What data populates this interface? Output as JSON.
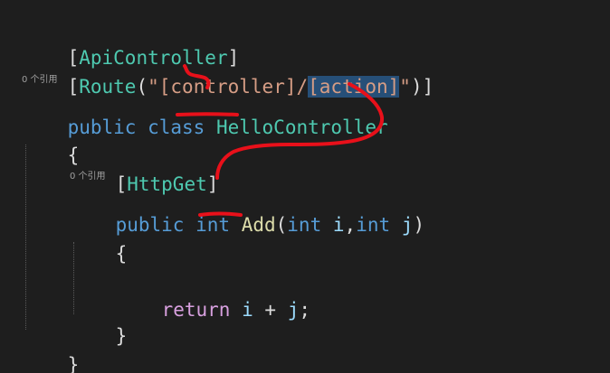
{
  "code": {
    "line1": {
      "open": "[",
      "attr": "ApiController",
      "close": "]"
    },
    "line2": {
      "open": "[",
      "attr": "Route",
      "paren_open": "(",
      "quote_open": "\"",
      "template_part1": "[controller]/",
      "template_part2": "[action]",
      "quote_close": "\"",
      "paren_close": ")",
      "close": "]"
    },
    "codelens_class": "0 个引用",
    "line3": {
      "kw_public": "public",
      "kw_class": "class",
      "class_name": "HelloController"
    },
    "line4": {
      "brace": "{"
    },
    "line5": {
      "open": "[",
      "attr": "HttpGet",
      "close": "]"
    },
    "codelens_method": "0 个引用",
    "line6": {
      "kw_public": "public",
      "kw_int": "int",
      "method_name": "Add",
      "paren_open": "(",
      "p1_type": "int",
      "p1_name": "i",
      "comma": ",",
      "p2_type": "int",
      "p2_name": "j",
      "paren_close": ")"
    },
    "line7": {
      "brace": "{"
    },
    "line8": {
      "kw_return": "return",
      "var_i": "i",
      "op": "+",
      "var_j": "j",
      "semicolon": ";"
    },
    "line9": {
      "brace": "}"
    },
    "line10": {
      "brace": "}"
    }
  },
  "colors": {
    "background": "#1e1e1e",
    "keyword": "#569cd6",
    "type": "#4ec9b0",
    "string": "#d69d85",
    "method": "#dcdcaa",
    "parameter": "#9cdcfe",
    "control": "#d8a0df",
    "selection": "#264f78",
    "annotation": "#e8101a"
  }
}
